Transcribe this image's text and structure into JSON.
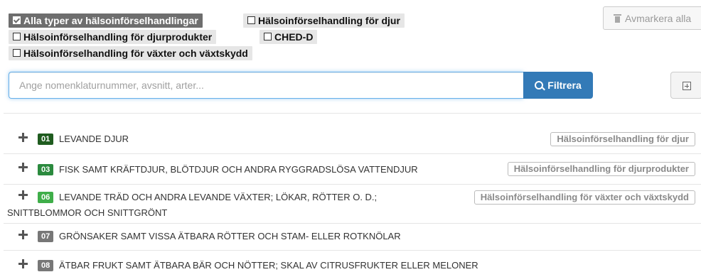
{
  "filters": {
    "all": "Alla typer av hälsoinförselhandlingar",
    "animals": "Hälsoinförselhandling för djur",
    "animal_products": "Hälsoinförselhandling för djurprodukter",
    "ched_d": "CHED-D",
    "plants": "Hälsoinförselhandling för växter och växtskydd"
  },
  "deselect_label": "Avmarkera alla",
  "search": {
    "placeholder": "Ange nomenklaturnummer, avsnitt, arter...",
    "value": ""
  },
  "filter_button": "Filtrera",
  "colors": {
    "primary": "#337ab7",
    "code_green": "#2b8a3e",
    "code_dark_green": "#1f5c1f",
    "code_gray": "#777777"
  },
  "rows": [
    {
      "code": "01",
      "title": "LEVANDE DJUR",
      "tag": "Hälsoinförselhandling för djur",
      "code_color": "#1f5c1f"
    },
    {
      "code": "03",
      "title": "FISK SAMT KRÄFTDJUR, BLÖTDJUR OCH ANDRA RYGGRADSLÖSA VATTENDJUR",
      "tag": "Hälsoinförselhandling för djurprodukter",
      "code_color": "#2b8a3e"
    },
    {
      "code": "06",
      "title_line1": "LEVANDE TRÄD OCH ANDRA LEVANDE VÄXTER; LÖKAR, RÖTTER O. D.;",
      "title_line2": "SNITTBLOMMOR OCH SNITTGRÖNT",
      "tag": "Hälsoinförselhandling för växter och växtskydd",
      "code_color": "#3fae49"
    },
    {
      "code": "07",
      "title": "GRÖNSAKER SAMT VISSA ÄTBARA RÖTTER OCH STAM- ELLER ROTKNÖLAR",
      "code_color": "#777777"
    },
    {
      "code": "08",
      "title": "ÄTBAR FRUKT SAMT ÄTBARA BÄR OCH NÖTTER; SKAL AV CITRUSFRUKTER ELLER MELONER",
      "code_color": "#777777"
    }
  ]
}
